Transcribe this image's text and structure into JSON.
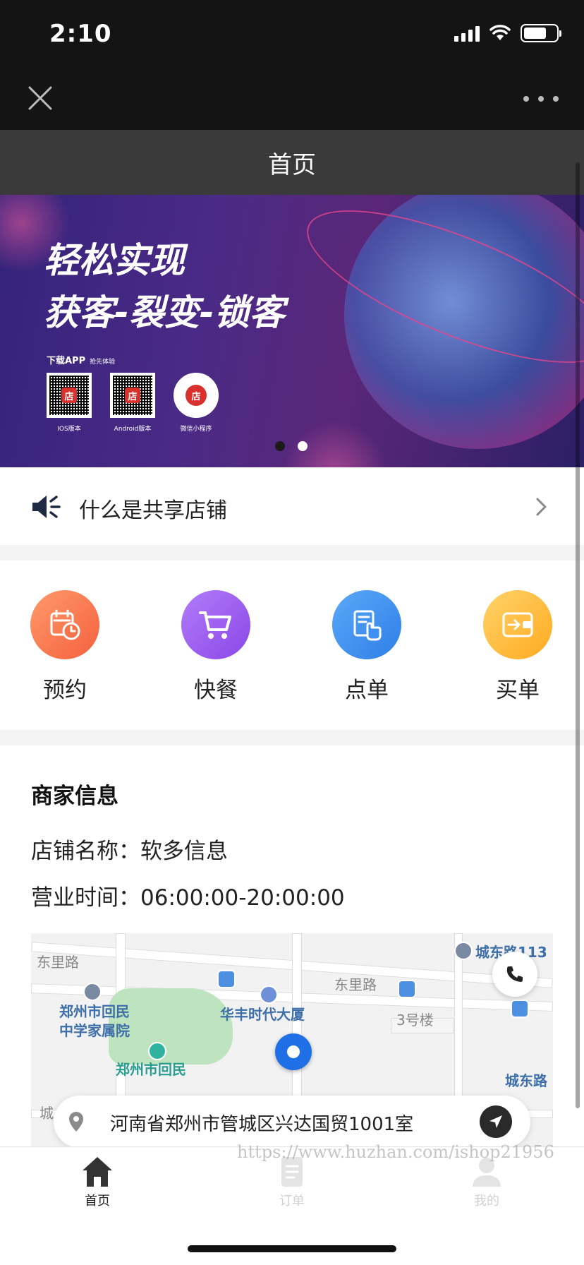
{
  "status_bar": {
    "time": "2:10"
  },
  "header": {
    "title": "首页"
  },
  "banner": {
    "headline_line1": "轻松实现",
    "headline_line2": "获客-裂变-锁客",
    "download_label": "下载APP",
    "download_sub": "抢先体验",
    "qr_codes": [
      {
        "label": "IOS版本",
        "glyph": "店"
      },
      {
        "label": "Android版本",
        "glyph": "店"
      },
      {
        "label": "微信小程序",
        "glyph": "店"
      }
    ],
    "active_slide": 2,
    "slide_count": 2
  },
  "notice": {
    "label": "什么是共享店铺",
    "icon": "speaker-icon"
  },
  "quick_actions": [
    {
      "label": "预约",
      "icon": "calendar-clock-icon",
      "color": "#f6734a"
    },
    {
      "label": "快餐",
      "icon": "cart-icon",
      "color": "#9b5cf0"
    },
    {
      "label": "点单",
      "icon": "order-hand-icon",
      "color": "#3d8ff2"
    },
    {
      "label": "买单",
      "icon": "wallet-icon",
      "color": "#ffbe2e"
    }
  ],
  "merchant": {
    "title": "商家信息",
    "name_line": "店铺名称：软多信息",
    "hours_line": "营业时间：06:00:00-20:00:00"
  },
  "map": {
    "labels": {
      "road_west": "东里路",
      "road_mid": "东里路",
      "road_east": "城东路113",
      "school": "郑州市回民\n中学家属院",
      "tower": "华丰时代大厦",
      "building": "3号楼",
      "school2": "郑州市回民",
      "road_southeast": "城东路",
      "road_southwest": "城"
    }
  },
  "address": {
    "text": "河南省郑州市管城区兴达国贸1001室"
  },
  "tabbar": {
    "tabs": [
      {
        "label": "首页",
        "icon": "home-icon",
        "active": true
      },
      {
        "label": "订单",
        "icon": "order-list-icon",
        "active": false
      },
      {
        "label": "我的",
        "icon": "user-icon",
        "active": false
      }
    ]
  },
  "watermark": "https://www.huzhan.com/ishop21956",
  "colors": {
    "status_bar": "#141414",
    "header": "#3a3a3a",
    "accent_blue": "#1f6fe6"
  }
}
